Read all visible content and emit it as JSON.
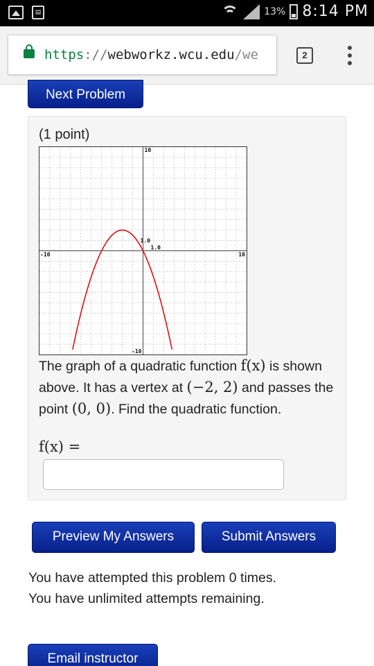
{
  "status_bar": {
    "battery_percent": "13%",
    "time": "8:14 PM",
    "notification_icons": [
      "gallery-icon",
      "document-icon"
    ]
  },
  "browser": {
    "url_scheme": "https",
    "url_sep": "://",
    "url_host": "webworkz.wcu.edu",
    "url_path": "/we",
    "tab_count": "2"
  },
  "page": {
    "next_problem": "Next Problem",
    "points": "(1 point)",
    "problem_text_1": "The graph of a quadratic function",
    "problem_fx": "f(x)",
    "problem_text_2": "is shown above. It has a vertex at",
    "vertex": "(−2, 2)",
    "problem_text_3": "and passes the point",
    "point": "(0, 0)",
    "problem_text_4": ". Find the quadratic function.",
    "answer_label": "f(x) =",
    "answer_value": "",
    "preview_button": "Preview My Answers",
    "submit_button": "Submit Answers",
    "attempts_line_1": "You have attempted this problem 0 times.",
    "attempts_line_2": "You have unlimited attempts remaining.",
    "email_button": "Email instructor"
  },
  "colors": {
    "button_blue": "#0a2a9c",
    "curve_red": "#e00000",
    "url_green": "#0b8043"
  },
  "chart_data": {
    "type": "line",
    "title": "",
    "xlabel": "",
    "ylabel": "",
    "xlim": [
      -10,
      10
    ],
    "ylim": [
      -10,
      10
    ],
    "grid": true,
    "tick_labels": {
      "x_min": "-10",
      "x_max": "10",
      "y_max": "10",
      "y_min": "-10",
      "x_unit": "1.0",
      "y_unit": "1.0"
    },
    "series": [
      {
        "x": [
          -6.8,
          -6,
          -5,
          -4,
          -3,
          -2,
          -1,
          0,
          1,
          2,
          2.8
        ],
        "y": [
          -9.52,
          -6,
          -2.5,
          0,
          1.5,
          2,
          1.5,
          0,
          -2.5,
          -6,
          -9.52
        ]
      }
    ]
  }
}
